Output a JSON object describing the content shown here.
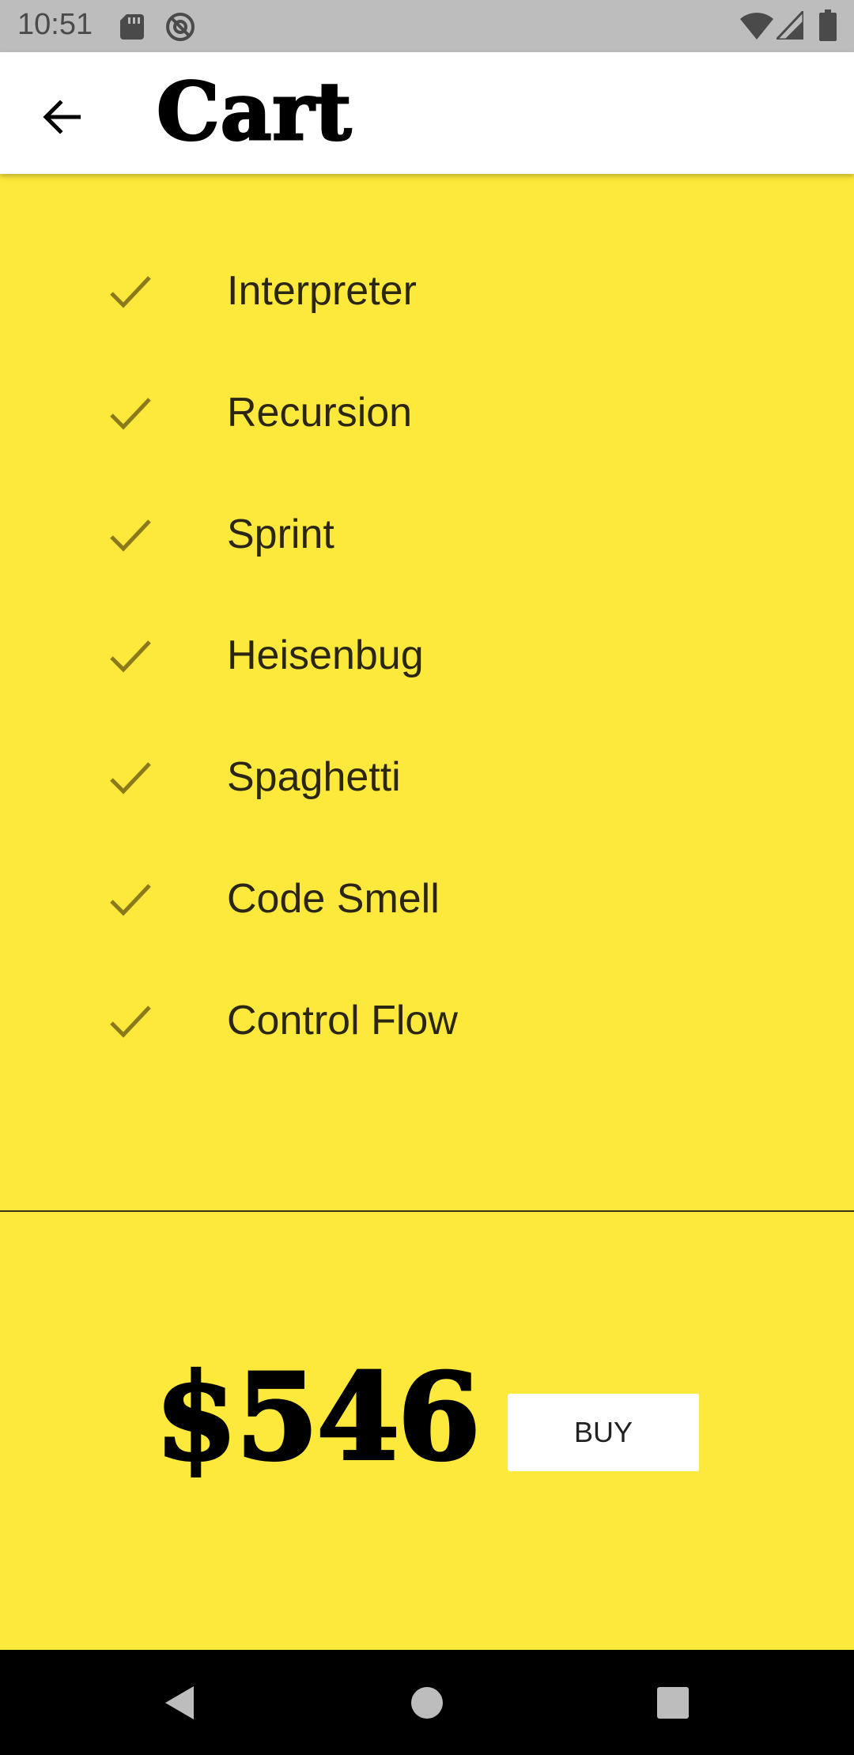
{
  "status_bar": {
    "time": "10:51",
    "left_icons": [
      "sd-card-icon",
      "at-sign-icon"
    ],
    "right_icons": [
      "wifi-icon",
      "cell-signal-icon",
      "battery-icon"
    ]
  },
  "app_bar": {
    "title": "Cart",
    "back_icon": "arrow-left-icon"
  },
  "cart": {
    "items": [
      {
        "label": "Interpreter",
        "checked": true
      },
      {
        "label": "Recursion",
        "checked": true
      },
      {
        "label": "Sprint",
        "checked": true
      },
      {
        "label": "Heisenbug",
        "checked": true
      },
      {
        "label": "Spaghetti",
        "checked": true
      },
      {
        "label": "Code Smell",
        "checked": true
      },
      {
        "label": "Control Flow",
        "checked": true
      }
    ],
    "total": "$546",
    "buy_label": "BUY"
  },
  "nav_bar": {
    "buttons": [
      "back-triangle-icon",
      "home-circle-icon",
      "recents-square-icon"
    ]
  },
  "colors": {
    "background": "#fde93b",
    "app_bar": "#ffffff",
    "check": "#8a7a1c",
    "status_bar": "#bdbdbd",
    "nav_bar": "#000000"
  }
}
